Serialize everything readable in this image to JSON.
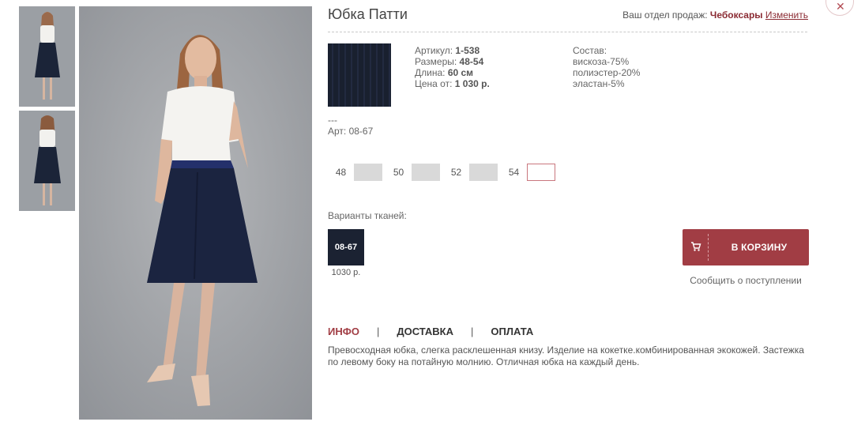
{
  "product": {
    "title": "Юбка Патти",
    "article_label": "Артикул:",
    "article_value": "1-538",
    "sizes_label": "Размеры:",
    "sizes_value": "48-54",
    "length_label": "Длина:",
    "length_value": "60 см",
    "price_label": "Цена от:",
    "price_value": "1 030 р.",
    "composition_label": "Состав:",
    "composition": [
      "вискоза-75%",
      "полиэстер-20%",
      "эластан-5%"
    ],
    "separator": "---",
    "fabric_article": "Арт: 08-67",
    "description": "Превосходная юбка, слегка расклешенная книзу. Изделие на кокетке.комбинированная экокожей. Застежка по левому боку на потайную молнию. Отличная юбка на каждый день."
  },
  "region": {
    "label": "Ваш отдел продаж:",
    "city": "Чебоксары",
    "change_link": "Изменить"
  },
  "sizes": [
    {
      "label": "48",
      "selected": false
    },
    {
      "label": "50",
      "selected": false
    },
    {
      "label": "52",
      "selected": false
    },
    {
      "label": "54",
      "selected": true
    }
  ],
  "variants": {
    "label": "Варианты тканей:",
    "items": [
      {
        "code": "08-67",
        "price": "1030 р."
      }
    ]
  },
  "actions": {
    "cart_button": "В КОРЗИНУ",
    "notify_link": "Сообщить о поступлении"
  },
  "tabs": [
    {
      "label": "ИНФО",
      "active": true
    },
    {
      "label": "ДОСТАВКА",
      "active": false
    },
    {
      "label": "ОПЛАТА",
      "active": false
    }
  ],
  "tab_separator": "|",
  "close_icon": "close-icon",
  "colors": {
    "accent": "#a13d44",
    "link": "#8b2b33",
    "fabric": "#1a2030"
  }
}
